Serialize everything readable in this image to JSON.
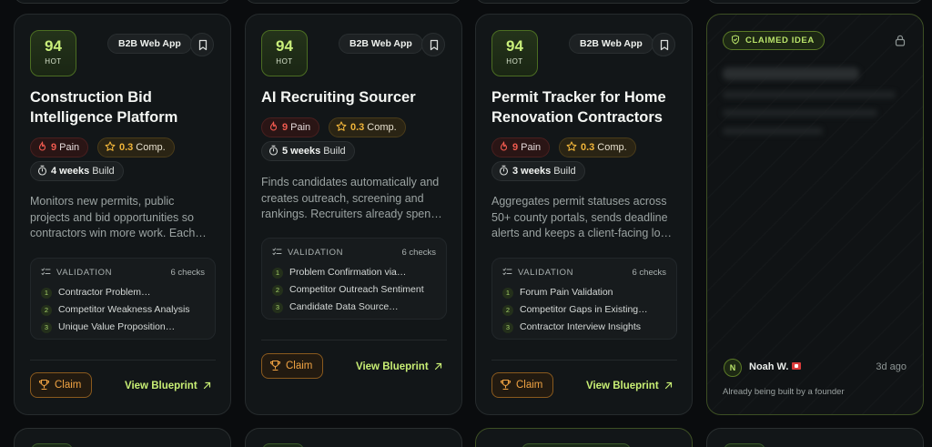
{
  "cards": [
    {
      "score": "94",
      "hot": "HOT",
      "tag": "B2B Web App",
      "title": "Construction Bid Intelligence Platform",
      "pain_value": "9",
      "pain_label": "Pain",
      "comp_value": "0.3",
      "comp_label": "Comp.",
      "build_value": "4 weeks",
      "build_label": "Build",
      "description": "Monitors new permits, public projects and bid opportunities so contractors win more work. Each…",
      "validation_label": "VALIDATION",
      "validation_checks": "6 checks",
      "validation_items": [
        {
          "n": "1",
          "label": "Contractor Problem…"
        },
        {
          "n": "2",
          "label": "Competitor Weakness Analysis"
        },
        {
          "n": "3",
          "label": "Unique Value Proposition…"
        }
      ],
      "claim_label": "Claim",
      "blueprint_label": "View Blueprint"
    },
    {
      "score": "94",
      "hot": "HOT",
      "tag": "B2B Web App",
      "title": "AI Recruiting Sourcer",
      "pain_value": "9",
      "pain_label": "Pain",
      "comp_value": "0.3",
      "comp_label": "Comp.",
      "build_value": "5 weeks",
      "build_label": "Build",
      "description": "Finds candidates automatically and creates outreach, screening and rankings. Recruiters already spen…",
      "validation_label": "VALIDATION",
      "validation_checks": "6 checks",
      "validation_items": [
        {
          "n": "1",
          "label": "Problem Confirmation via…"
        },
        {
          "n": "2",
          "label": "Competitor Outreach Sentiment"
        },
        {
          "n": "3",
          "label": "Candidate Data Source…"
        }
      ],
      "claim_label": "Claim",
      "blueprint_label": "View Blueprint"
    },
    {
      "score": "94",
      "hot": "HOT",
      "tag": "B2B Web App",
      "title": "Permit Tracker for Home Renovation Contractors",
      "pain_value": "9",
      "pain_label": "Pain",
      "comp_value": "0.3",
      "comp_label": "Comp.",
      "build_value": "3 weeks",
      "build_label": "Build",
      "description": "Aggregates permit statuses across 50+ county portals, sends deadline alerts and keeps a client-facing lo…",
      "validation_label": "VALIDATION",
      "validation_checks": "6 checks",
      "validation_items": [
        {
          "n": "1",
          "label": "Forum Pain Validation"
        },
        {
          "n": "2",
          "label": "Competitor Gaps in Existing…"
        },
        {
          "n": "3",
          "label": "Contractor Interview Insights"
        }
      ],
      "claim_label": "Claim",
      "blueprint_label": "View Blueprint"
    }
  ],
  "claimed": {
    "badge": "CLAIMED IDEA",
    "owner_initial": "N",
    "owner_name": "Noah W.",
    "time": "3d ago",
    "note": "Already being built by a founder"
  },
  "colors": {
    "accent_green": "#c8ee74",
    "pain_red": "#ef5a4f",
    "comp_amber": "#f0b53a",
    "claim_orange": "#f0a343"
  },
  "icons": {
    "bookmark": "bookmark-icon",
    "flame": "flame-icon",
    "star": "star-icon",
    "timer": "stopwatch-icon",
    "checklist": "checklist-icon",
    "trophy": "trophy-icon",
    "arrow": "arrow-up-right-icon",
    "shield": "shield-check-icon",
    "lock": "lock-icon",
    "flag": "canada-flag-icon"
  }
}
